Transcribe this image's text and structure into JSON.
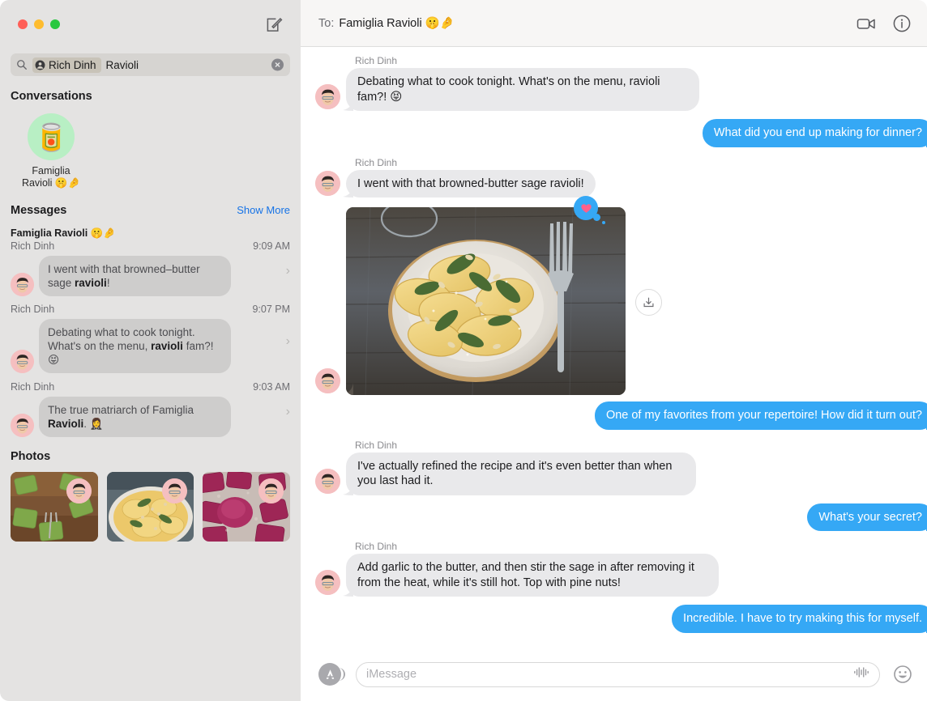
{
  "window": {
    "traffic_lights": [
      "close",
      "minimize",
      "zoom"
    ],
    "compose_icon": "compose-icon",
    "colors": {
      "imessage_blue": "#35a8f5",
      "bubble_gray": "#e9e9eb",
      "sidebar_bg": "#e4e3e2",
      "link_blue": "#1673e6",
      "avatar_pink": "#f5bfc0",
      "conv_avatar_green": "#b8efc4"
    }
  },
  "sidebar": {
    "search": {
      "icon": "search-icon",
      "token_icon": "contact-person-icon",
      "token_label": "Rich Dinh",
      "query_text": "Ravioli",
      "clear_icon": "clear-circle-icon"
    },
    "conversations_section": {
      "title": "Conversations",
      "items": [
        {
          "avatar_emoji": "🥫",
          "name_line1": "Famiglia",
          "name_line2": "Ravioli 🤫🤌"
        }
      ]
    },
    "messages_section": {
      "title": "Messages",
      "show_more_label": "Show More",
      "results": [
        {
          "group_title": "Famiglia Ravioli 🤫🤌",
          "sender": "Rich Dinh",
          "time": "9:09 AM",
          "text_before": "I went with that browned–butter sage ",
          "text_match": "ravioli",
          "text_after": "!"
        },
        {
          "group_title": "",
          "sender": "Rich Dinh",
          "time": "9:07 PM",
          "text_before": "Debating what to cook tonight. What's on the menu, ",
          "text_match": "ravioli",
          "text_after": " fam?! 😝"
        },
        {
          "group_title": "",
          "sender": "Rich Dinh",
          "time": "9:03 AM",
          "text_before": "The true matriarch of Famiglia ",
          "text_match": "Ravioli",
          "text_after": ". 🤵‍♀️"
        }
      ]
    },
    "photos_section": {
      "title": "Photos",
      "items": [
        {
          "description": "green spinach ravioli on wooden board with fork"
        },
        {
          "description": "yellow ravioli with sage and pine nuts on plate"
        },
        {
          "description": "magenta beet ravioli dusted with flour"
        }
      ]
    }
  },
  "conversation": {
    "header": {
      "to_label": "To:",
      "recipient": "Famiglia Ravioli 🤫🤌",
      "facetime_icon": "video-camera-icon",
      "info_icon": "info-circle-icon"
    },
    "messages": [
      {
        "direction": "incoming",
        "sender": "Rich Dinh",
        "text": "Debating what to cook tonight. What's on the menu, ravioli fam?! 😝",
        "show_sender": true,
        "show_avatar": true
      },
      {
        "direction": "outgoing",
        "text": "What did you end up making for dinner?"
      },
      {
        "direction": "incoming",
        "sender": "Rich Dinh",
        "text": "I went with that browned-butter sage ravioli!",
        "show_sender": true,
        "show_avatar": true
      },
      {
        "direction": "incoming",
        "type": "photo",
        "photo_description": "plate of ravioli with sage leaves on rustic dark wood table with fork",
        "tapback": "heart",
        "download_button": "download-icon",
        "show_avatar": true
      },
      {
        "direction": "outgoing",
        "text": "One of my favorites from your repertoire! How did it turn out?"
      },
      {
        "direction": "incoming",
        "sender": "Rich Dinh",
        "text": "I've actually refined the recipe and it's even better than when you last had it.",
        "show_sender": true,
        "show_avatar": true
      },
      {
        "direction": "outgoing",
        "text": "What's your secret?"
      },
      {
        "direction": "incoming",
        "sender": "Rich Dinh",
        "text": "Add garlic to the butter, and then stir the sage in after removing it from the heat, while it's still hot. Top with pine nuts!",
        "show_sender": true,
        "show_avatar": true
      },
      {
        "direction": "outgoing",
        "text": "Incredible. I have to try making this for myself."
      }
    ],
    "input_bar": {
      "apps_icon": "app-store-icon",
      "placeholder": "iMessage",
      "audio_icon": "audio-waveform-icon",
      "emoji_icon": "emoji-smiley-icon"
    }
  }
}
